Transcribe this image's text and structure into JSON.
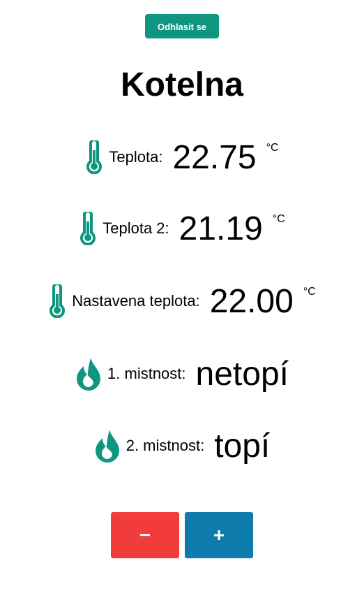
{
  "header": {
    "logout_label": "Odhlasit se",
    "title": "Kotelna"
  },
  "colors": {
    "accent": "#0f9680",
    "minus_button": "#f23c3c",
    "plus_button": "#0d7bab"
  },
  "readings": [
    {
      "icon": "thermometer-icon",
      "label": "Teplota:",
      "value": "22.75",
      "unit": "°C"
    },
    {
      "icon": "thermometer-icon",
      "label": "Teplota 2:",
      "value": "21.19",
      "unit": "°C"
    },
    {
      "icon": "thermometer-icon",
      "label": "Nastavena teplota:",
      "value": "22.00",
      "unit": "°C"
    }
  ],
  "rooms": [
    {
      "icon": "flame-icon",
      "label": "1. mistnost:",
      "status": "netopí"
    },
    {
      "icon": "flame-icon",
      "label": "2. mistnost:",
      "status": "topí"
    }
  ],
  "controls": {
    "decrease_label": "−",
    "increase_label": "+"
  }
}
